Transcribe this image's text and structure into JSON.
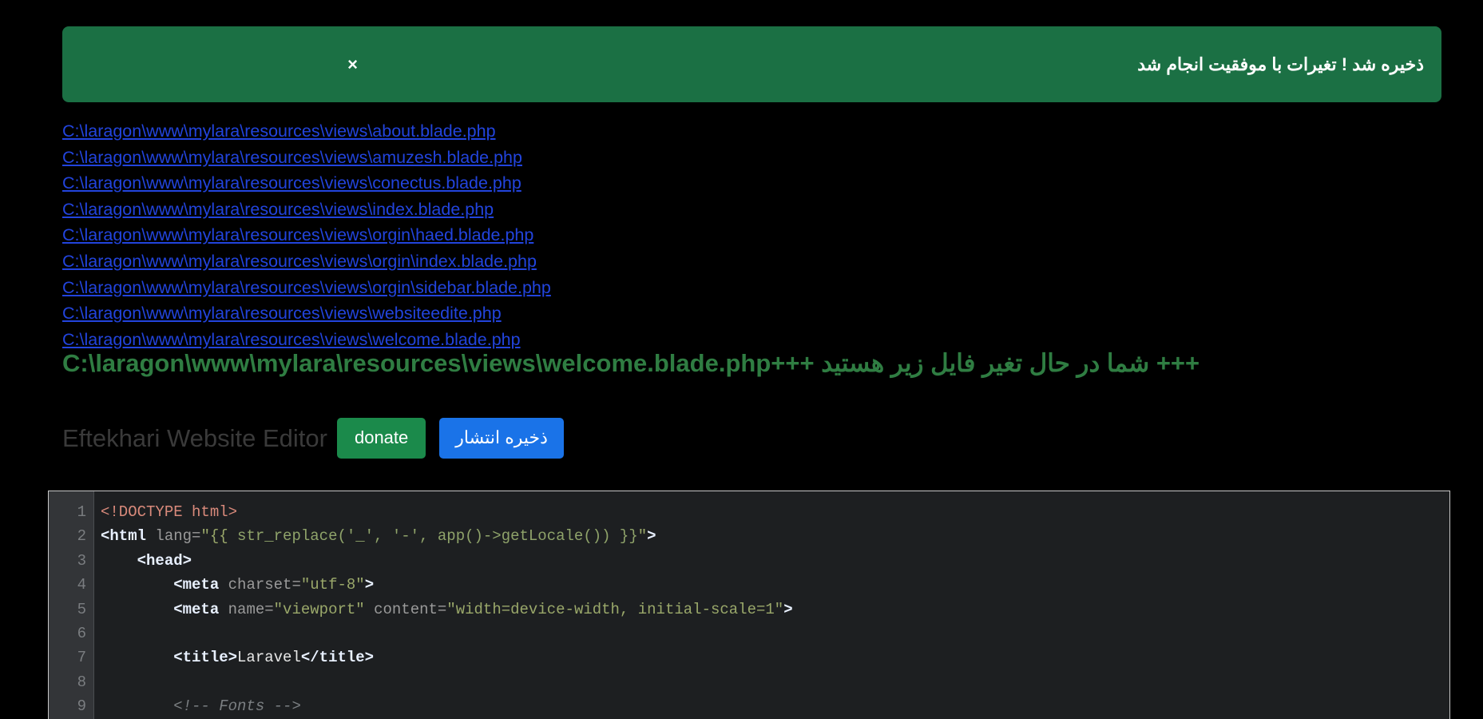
{
  "alert": {
    "message": "ذخیره شد ! تغیرات با موفقیت انجام شد",
    "close_label": "×",
    "background_color": "#1b7044",
    "text_color": "#ffffff"
  },
  "file_links": [
    "C:\\laragon\\www\\mylara\\resources\\views\\about.blade.php",
    "C:\\laragon\\www\\mylara\\resources\\views\\amuzesh.blade.php",
    "C:\\laragon\\www\\mylara\\resources\\views\\conectus.blade.php",
    "C:\\laragon\\www\\mylara\\resources\\views\\index.blade.php",
    "C:\\laragon\\www\\mylara\\resources\\views\\orgin\\haed.blade.php",
    "C:\\laragon\\www\\mylara\\resources\\views\\orgin\\index.blade.php",
    "C:\\laragon\\www\\mylara\\resources\\views\\orgin\\sidebar.blade.php",
    "C:\\laragon\\www\\mylara\\resources\\views\\websiteedite.php",
    "C:\\laragon\\www\\mylara\\resources\\views\\welcome.blade.php"
  ],
  "current_file": {
    "text": "+++ شما در حال تغیر فایل زیر هستید +++C:\\laragon\\www\\mylara\\resources\\views\\welcome.blade.php",
    "color": "#2f7d42"
  },
  "toolbar": {
    "title": "Eftekhari Website Editor",
    "donate_label": "donate",
    "donate_color": "#1b8a4b",
    "publish_label": "ذخیره انتشار",
    "publish_color": "#1a73e8"
  },
  "editor": {
    "background_color": "#1d1f21",
    "gutter_color": "#333538",
    "line_numbers": [
      1,
      2,
      3,
      4,
      5,
      6,
      7,
      8,
      9
    ],
    "lines": [
      {
        "n": 1,
        "tokens": [
          {
            "t": "doctype",
            "v": "<!DOCTYPE html>"
          }
        ]
      },
      {
        "n": 2,
        "tokens": [
          {
            "t": "tag",
            "v": "<html "
          },
          {
            "t": "attr",
            "v": "lang="
          },
          {
            "t": "str",
            "v": "\"{{ "
          },
          {
            "t": "expr",
            "v": "str_replace('_', '-', app()->getLocale()) }}"
          },
          {
            "t": "str",
            "v": "\""
          },
          {
            "t": "tag",
            "v": ">"
          }
        ]
      },
      {
        "n": 3,
        "tokens": [
          {
            "t": "tag",
            "v": "    <head>"
          }
        ]
      },
      {
        "n": 4,
        "tokens": [
          {
            "t": "tag",
            "v": "        <meta "
          },
          {
            "t": "attr",
            "v": "charset="
          },
          {
            "t": "str",
            "v": "\"utf-8\""
          },
          {
            "t": "tag",
            "v": ">"
          }
        ]
      },
      {
        "n": 5,
        "tokens": [
          {
            "t": "tag",
            "v": "        <meta "
          },
          {
            "t": "attr",
            "v": "name="
          },
          {
            "t": "str",
            "v": "\"viewport\""
          },
          {
            "t": "attr",
            "v": " content="
          },
          {
            "t": "str",
            "v": "\"width=device-width, initial-scale=1\""
          },
          {
            "t": "tag",
            "v": ">"
          }
        ]
      },
      {
        "n": 6,
        "tokens": [
          {
            "t": "text",
            "v": ""
          }
        ]
      },
      {
        "n": 7,
        "tokens": [
          {
            "t": "tag",
            "v": "        <title>"
          },
          {
            "t": "text",
            "v": "Laravel"
          },
          {
            "t": "tag",
            "v": "</title>"
          }
        ]
      },
      {
        "n": 8,
        "tokens": [
          {
            "t": "text",
            "v": ""
          }
        ]
      },
      {
        "n": 9,
        "tokens": [
          {
            "t": "comment",
            "v": "        <!-- Fonts -->"
          }
        ]
      }
    ]
  }
}
